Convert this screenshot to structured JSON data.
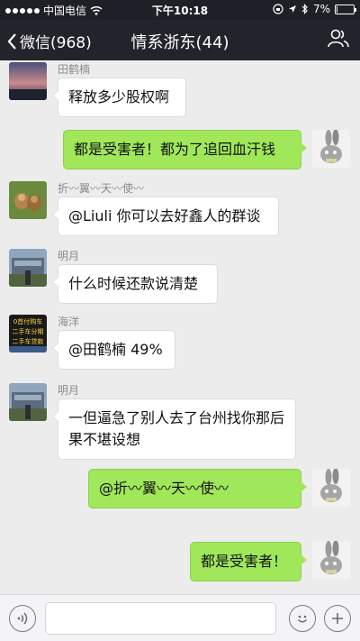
{
  "status_bar": {
    "carrier": "中国电信",
    "time": "下午10:18",
    "battery_percent": "7%",
    "battery_level": 0.07
  },
  "nav": {
    "back_label": "微信(968)",
    "title": "情系浙东(44)",
    "people_icon": "people-icon"
  },
  "messages": [
    {
      "side": "in",
      "sender": "田鹤楠",
      "text": "释放多少股权啊"
    },
    {
      "side": "out",
      "text": "都是受害者！都为了追回血汗钱"
    },
    {
      "side": "in",
      "sender": "折〰翼〰天〰使〰",
      "text": "@Liuli 你可以去好鑫人的群谈"
    },
    {
      "side": "in",
      "sender": "明月",
      "text": "什么时候还款说清楚"
    },
    {
      "side": "in",
      "sender": "海洋",
      "text": "@田鹤楠 49%"
    },
    {
      "side": "in",
      "sender": "明月",
      "text": "一但逼急了别人去了台州找你那后果不堪设想"
    },
    {
      "side": "out",
      "text": "@折〰翼〰天〰使〰"
    },
    {
      "side": "out",
      "text": "都是受害者！"
    }
  ],
  "avatar_haiyang_text": "0首付购车 二手车分期 二手车贷款",
  "input": {
    "voice_icon": "voice-icon",
    "emoji_icon": "emoji-icon",
    "plus_icon": "plus-icon"
  }
}
